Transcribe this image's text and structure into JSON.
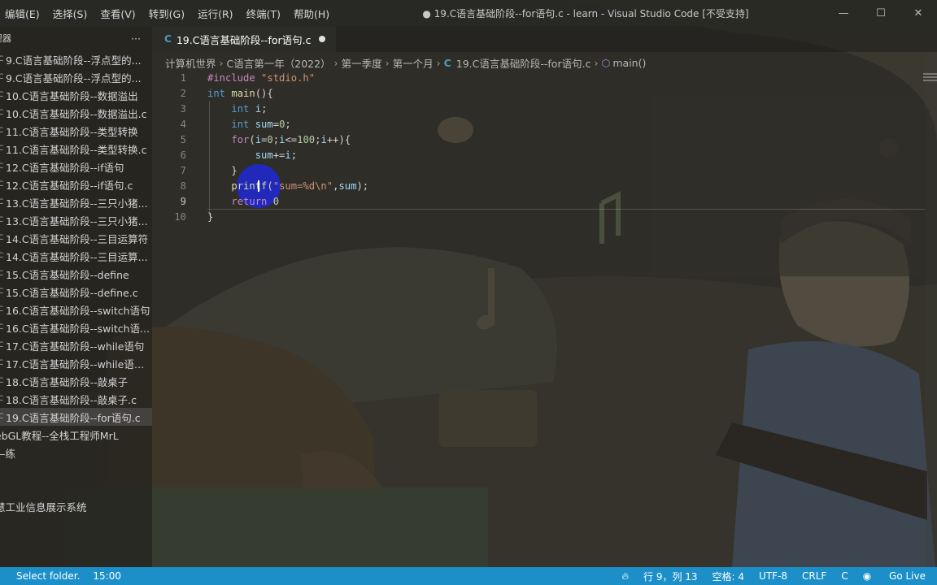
{
  "menu": [
    "编辑(E)",
    "选择(S)",
    "查看(V)",
    "转到(G)",
    "运行(R)",
    "终端(T)",
    "帮助(H)"
  ],
  "window_title": "● 19.C语言基础阶段--for语句.c - learn - Visual Studio Code [不受支持]",
  "window_controls": {
    "minimize": "—",
    "maximize": "☐",
    "close": "✕"
  },
  "sidebar": {
    "header": "理器",
    "more": "···",
    "files": [
      {
        "icon": "C",
        "label": "9.C语言基础阶段--浮点型的..."
      },
      {
        "icon": "C",
        "label": "9.C语言基础阶段--浮点型的..."
      },
      {
        "icon": "C",
        "label": "10.C语言基础阶段--数据溢出"
      },
      {
        "icon": "C",
        "label": "10.C语言基础阶段--数据溢出.c"
      },
      {
        "icon": "C",
        "label": "11.C语言基础阶段--类型转换"
      },
      {
        "icon": "C",
        "label": "11.C语言基础阶段--类型转换.c"
      },
      {
        "icon": "C",
        "label": "12.C语言基础阶段--if语句"
      },
      {
        "icon": "C",
        "label": "12.C语言基础阶段--if语句.c"
      },
      {
        "icon": "C",
        "label": "13.C语言基础阶段--三只小猪..."
      },
      {
        "icon": "C",
        "label": "13.C语言基础阶段--三只小猪..."
      },
      {
        "icon": "C",
        "label": "14.C语言基础阶段--三目运算符"
      },
      {
        "icon": "C",
        "label": "14.C语言基础阶段--三目运算..."
      },
      {
        "icon": "C",
        "label": "15.C语言基础阶段--define"
      },
      {
        "icon": "C",
        "label": "15.C语言基础阶段--define.c"
      },
      {
        "icon": "C",
        "label": "16.C语言基础阶段--switch语句"
      },
      {
        "icon": "C",
        "label": "16.C语言基础阶段--switch语..."
      },
      {
        "icon": "C",
        "label": "17.C语言基础阶段--while语句"
      },
      {
        "icon": "C",
        "label": "17.C语言基础阶段--while语句.c"
      },
      {
        "icon": "C",
        "label": "18.C语言基础阶段--敲桌子"
      },
      {
        "icon": "C",
        "label": "18.C语言基础阶段--敲桌子.c"
      },
      {
        "icon": "C",
        "label": "19.C语言基础阶段--for语句.c"
      }
    ],
    "folders": [
      "ebGL教程--全栈工程师MrL",
      "—练",
      "",
      "",
      "慧工业信息展示系统"
    ]
  },
  "tab": {
    "icon": "C",
    "label": "19.C语言基础阶段--for语句.c"
  },
  "breadcrumb": [
    "计算机世界",
    "C语言第一年（2022）",
    "第一季度",
    "第一个月",
    "19.C语言基础阶段--for语句.c",
    "main()"
  ],
  "code_lines": [
    {
      "n": "1"
    },
    {
      "n": "2"
    },
    {
      "n": "3"
    },
    {
      "n": "4"
    },
    {
      "n": "5"
    },
    {
      "n": "6"
    },
    {
      "n": "7"
    },
    {
      "n": "8"
    },
    {
      "n": "9"
    },
    {
      "n": "10"
    }
  ],
  "code_text": {
    "l1_pp": "#include",
    "l1_s": "\"stdio.h\"",
    "l2_k": "int",
    "l2_f": "main",
    "l2_r": "(){",
    "l3_k": "int",
    "l3_v": "i",
    "l3_r": ";",
    "l4_k": "int",
    "l4_v": "sum",
    "l4_r": "=",
    "l4_n": "0",
    "l4_e": ";",
    "l5_c": "for",
    "l5_a": "(",
    "l5_v1": "i",
    "l5_b": "=",
    "l5_n1": "0",
    "l5_c2": ";",
    "l5_v2": "i",
    "l5_d": "<=",
    "l5_n2": "100",
    "l5_e": ";",
    "l5_v3": "i",
    "l5_f": "++){",
    "l6_v1": "sum",
    "l6_a": "+=",
    "l6_v2": "i",
    "l6_b": ";",
    "l7": "}",
    "l8_f": "printf",
    "l8_a": "(",
    "l8_s": "\"sum=%d\\n\"",
    "l8_b": ",",
    "l8_v": "sum",
    "l8_c": ");",
    "l9_c": "return",
    "l9_n": "0",
    "l10": "}"
  },
  "status": {
    "select_folder": "Select folder.",
    "time": "15:00",
    "position": "行 9，列 13",
    "spaces": "空格: 4",
    "encoding": "UTF-8",
    "eol": "CRLF",
    "language": "C",
    "live": "Go Live"
  },
  "colors": {
    "statusbar": "#1c8fc9",
    "accent_c_icon": "#519aba",
    "cursor_highlight": "#1e28dc"
  }
}
